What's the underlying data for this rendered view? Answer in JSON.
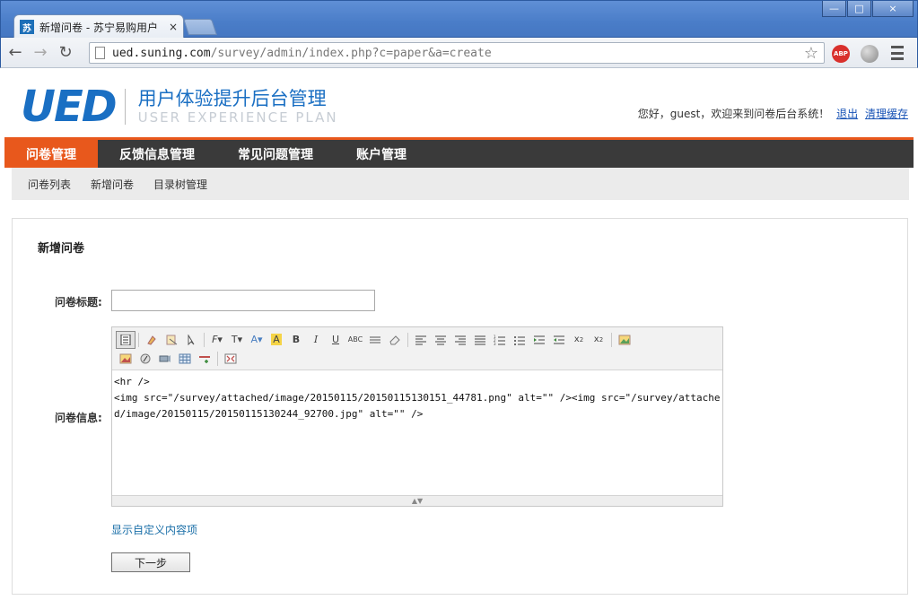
{
  "browser": {
    "tab_title": "新增问卷 - 苏宁易购用户",
    "favicon_text": "苏",
    "tab_close": "×",
    "url_host": "ued.suning.com",
    "url_path": "/survey/admin/index.php?c=paper&a=create",
    "abp_label": "ABP",
    "win_min": "—",
    "win_max": "□",
    "win_close": "×"
  },
  "header": {
    "logo_mark": "UED",
    "logo_cn": "用户体验提升后台管理",
    "logo_en": "USER EXPERIENCE PLAN",
    "greeting": "您好，guest，欢迎来到问卷后台系统！",
    "logout": "退出",
    "clear_cache": "清理缓存"
  },
  "main_nav": [
    {
      "label": "问卷管理",
      "active": true
    },
    {
      "label": "反馈信息管理",
      "active": false
    },
    {
      "label": "常见问题管理",
      "active": false
    },
    {
      "label": "账户管理",
      "active": false
    }
  ],
  "sub_nav": [
    "问卷列表",
    "新增问卷",
    "目录树管理"
  ],
  "form": {
    "panel_title": "新增问卷",
    "title_label": "问卷标题:",
    "title_value": "",
    "info_label": "问卷信息:",
    "editor_content": "<hr />\n<img src=\"/survey/attached/image/20150115/20150115130151_44781.png\" alt=\"\" /><img src=\"/survey/attached/image/20150115/20150115130244_92700.jpg\" alt=\"\" />",
    "custom_link": "显示自定义内容项",
    "next_button": "下一步"
  },
  "colors": {
    "accent": "#e8581c",
    "nav_bg": "#3a3a3a",
    "brand_blue": "#1a6fc3",
    "link": "#1a54b6"
  }
}
